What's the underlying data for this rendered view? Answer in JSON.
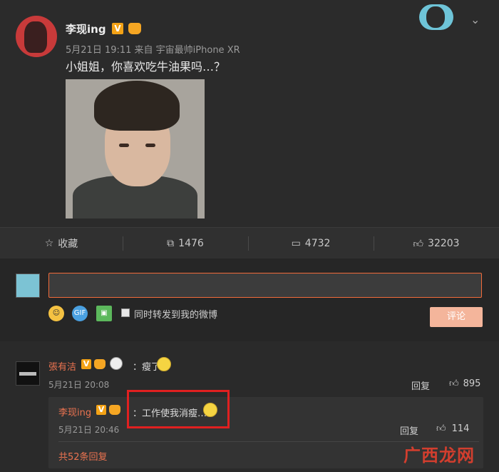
{
  "post": {
    "author": "李现ing",
    "verified_badge": "V",
    "meta": "5月21日 19:11 来自 宇宙最帅iPhone XR",
    "text": "小姐姐，你喜欢吃牛油果吗…？"
  },
  "actions": {
    "favorite_label": "收藏",
    "repost_count": "1476",
    "comment_count": "4732",
    "like_count": "32203"
  },
  "composer": {
    "repost_checkbox_label": "同时转发到我的微博",
    "submit_label": "评论",
    "gif_label": "GIF"
  },
  "comment": {
    "author": "張有洁",
    "verified_badge": "V",
    "text": "：瘦了",
    "time": "5月21日 20:08",
    "reply_label": "回复",
    "like_count": "895"
  },
  "reply": {
    "author": "李现ing",
    "verified_badge": "V",
    "text": "：工作使我消瘦…",
    "time": "5月21日 20:46",
    "reply_label": "回复",
    "like_count": "114",
    "more_label": "共52条回复"
  },
  "watermark": "广西龙网",
  "colors": {
    "accent": "#eb7350",
    "highlight": "#e02020",
    "badge": "#f3a216"
  }
}
